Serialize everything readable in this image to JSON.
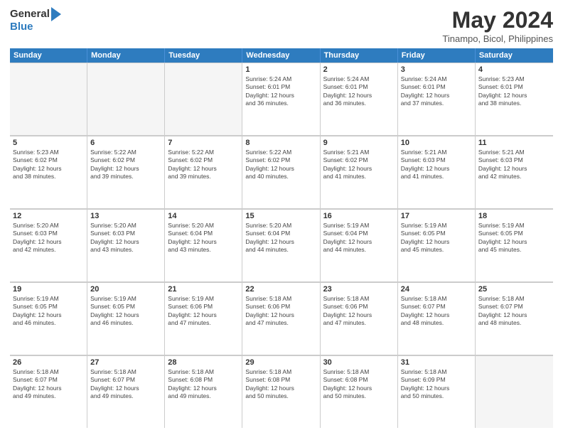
{
  "header": {
    "logo_general": "General",
    "logo_blue": "Blue",
    "month_title": "May 2024",
    "location": "Tinampo, Bicol, Philippines"
  },
  "days_of_week": [
    "Sunday",
    "Monday",
    "Tuesday",
    "Wednesday",
    "Thursday",
    "Friday",
    "Saturday"
  ],
  "weeks": [
    [
      {
        "day": "",
        "info": "",
        "empty": true
      },
      {
        "day": "",
        "info": "",
        "empty": true
      },
      {
        "day": "",
        "info": "",
        "empty": true
      },
      {
        "day": "1",
        "info": "Sunrise: 5:24 AM\nSunset: 6:01 PM\nDaylight: 12 hours\nand 36 minutes.",
        "empty": false
      },
      {
        "day": "2",
        "info": "Sunrise: 5:24 AM\nSunset: 6:01 PM\nDaylight: 12 hours\nand 36 minutes.",
        "empty": false
      },
      {
        "day": "3",
        "info": "Sunrise: 5:24 AM\nSunset: 6:01 PM\nDaylight: 12 hours\nand 37 minutes.",
        "empty": false
      },
      {
        "day": "4",
        "info": "Sunrise: 5:23 AM\nSunset: 6:01 PM\nDaylight: 12 hours\nand 38 minutes.",
        "empty": false
      }
    ],
    [
      {
        "day": "5",
        "info": "Sunrise: 5:23 AM\nSunset: 6:02 PM\nDaylight: 12 hours\nand 38 minutes.",
        "empty": false
      },
      {
        "day": "6",
        "info": "Sunrise: 5:22 AM\nSunset: 6:02 PM\nDaylight: 12 hours\nand 39 minutes.",
        "empty": false
      },
      {
        "day": "7",
        "info": "Sunrise: 5:22 AM\nSunset: 6:02 PM\nDaylight: 12 hours\nand 39 minutes.",
        "empty": false
      },
      {
        "day": "8",
        "info": "Sunrise: 5:22 AM\nSunset: 6:02 PM\nDaylight: 12 hours\nand 40 minutes.",
        "empty": false
      },
      {
        "day": "9",
        "info": "Sunrise: 5:21 AM\nSunset: 6:02 PM\nDaylight: 12 hours\nand 41 minutes.",
        "empty": false
      },
      {
        "day": "10",
        "info": "Sunrise: 5:21 AM\nSunset: 6:03 PM\nDaylight: 12 hours\nand 41 minutes.",
        "empty": false
      },
      {
        "day": "11",
        "info": "Sunrise: 5:21 AM\nSunset: 6:03 PM\nDaylight: 12 hours\nand 42 minutes.",
        "empty": false
      }
    ],
    [
      {
        "day": "12",
        "info": "Sunrise: 5:20 AM\nSunset: 6:03 PM\nDaylight: 12 hours\nand 42 minutes.",
        "empty": false
      },
      {
        "day": "13",
        "info": "Sunrise: 5:20 AM\nSunset: 6:03 PM\nDaylight: 12 hours\nand 43 minutes.",
        "empty": false
      },
      {
        "day": "14",
        "info": "Sunrise: 5:20 AM\nSunset: 6:04 PM\nDaylight: 12 hours\nand 43 minutes.",
        "empty": false
      },
      {
        "day": "15",
        "info": "Sunrise: 5:20 AM\nSunset: 6:04 PM\nDaylight: 12 hours\nand 44 minutes.",
        "empty": false
      },
      {
        "day": "16",
        "info": "Sunrise: 5:19 AM\nSunset: 6:04 PM\nDaylight: 12 hours\nand 44 minutes.",
        "empty": false
      },
      {
        "day": "17",
        "info": "Sunrise: 5:19 AM\nSunset: 6:05 PM\nDaylight: 12 hours\nand 45 minutes.",
        "empty": false
      },
      {
        "day": "18",
        "info": "Sunrise: 5:19 AM\nSunset: 6:05 PM\nDaylight: 12 hours\nand 45 minutes.",
        "empty": false
      }
    ],
    [
      {
        "day": "19",
        "info": "Sunrise: 5:19 AM\nSunset: 6:05 PM\nDaylight: 12 hours\nand 46 minutes.",
        "empty": false
      },
      {
        "day": "20",
        "info": "Sunrise: 5:19 AM\nSunset: 6:05 PM\nDaylight: 12 hours\nand 46 minutes.",
        "empty": false
      },
      {
        "day": "21",
        "info": "Sunrise: 5:19 AM\nSunset: 6:06 PM\nDaylight: 12 hours\nand 47 minutes.",
        "empty": false
      },
      {
        "day": "22",
        "info": "Sunrise: 5:18 AM\nSunset: 6:06 PM\nDaylight: 12 hours\nand 47 minutes.",
        "empty": false
      },
      {
        "day": "23",
        "info": "Sunrise: 5:18 AM\nSunset: 6:06 PM\nDaylight: 12 hours\nand 47 minutes.",
        "empty": false
      },
      {
        "day": "24",
        "info": "Sunrise: 5:18 AM\nSunset: 6:07 PM\nDaylight: 12 hours\nand 48 minutes.",
        "empty": false
      },
      {
        "day": "25",
        "info": "Sunrise: 5:18 AM\nSunset: 6:07 PM\nDaylight: 12 hours\nand 48 minutes.",
        "empty": false
      }
    ],
    [
      {
        "day": "26",
        "info": "Sunrise: 5:18 AM\nSunset: 6:07 PM\nDaylight: 12 hours\nand 49 minutes.",
        "empty": false
      },
      {
        "day": "27",
        "info": "Sunrise: 5:18 AM\nSunset: 6:07 PM\nDaylight: 12 hours\nand 49 minutes.",
        "empty": false
      },
      {
        "day": "28",
        "info": "Sunrise: 5:18 AM\nSunset: 6:08 PM\nDaylight: 12 hours\nand 49 minutes.",
        "empty": false
      },
      {
        "day": "29",
        "info": "Sunrise: 5:18 AM\nSunset: 6:08 PM\nDaylight: 12 hours\nand 50 minutes.",
        "empty": false
      },
      {
        "day": "30",
        "info": "Sunrise: 5:18 AM\nSunset: 6:08 PM\nDaylight: 12 hours\nand 50 minutes.",
        "empty": false
      },
      {
        "day": "31",
        "info": "Sunrise: 5:18 AM\nSunset: 6:09 PM\nDaylight: 12 hours\nand 50 minutes.",
        "empty": false
      },
      {
        "day": "",
        "info": "",
        "empty": true
      }
    ]
  ]
}
